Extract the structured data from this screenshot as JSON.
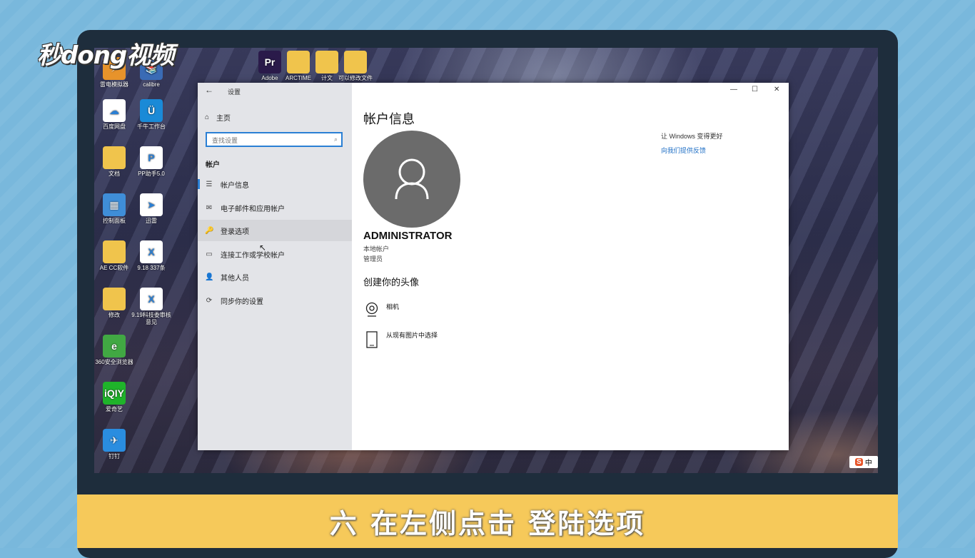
{
  "caption": "六 在左侧点击 登陆选项",
  "logo": "秒dong视频",
  "desktop_icons": [
    {
      "label": "雷电模拟器",
      "color": "#e7932b",
      "glyph": "⚡"
    },
    {
      "label": "calibre",
      "color": "#3a6bb5",
      "glyph": "📚"
    },
    {
      "label": "Adobe",
      "color": "#2a1a4a",
      "glyph": "Pr"
    },
    {
      "label": "ARCTIME",
      "color": "#f0c44c",
      "glyph": ""
    },
    {
      "label": "计文",
      "color": "#f0c44c",
      "glyph": ""
    },
    {
      "label": "可以修改文件",
      "color": "#f0c44c",
      "glyph": ""
    },
    {
      "label": "百度网盘",
      "color": "#ffffff",
      "glyph": "☁"
    },
    {
      "label": "千牛工作台",
      "color": "#1a8ad7",
      "glyph": "Ü"
    },
    {
      "label": "文档",
      "color": "#f0c44c",
      "glyph": ""
    },
    {
      "label": "PP助手5.0",
      "color": "#ffffff",
      "glyph": "P"
    },
    {
      "label": "控制面板",
      "color": "#3f8ed8",
      "glyph": "▦"
    },
    {
      "label": "迅雷",
      "color": "#ffffff",
      "glyph": "➤"
    },
    {
      "label": "AE CC软件",
      "color": "#f0c44c",
      "glyph": ""
    },
    {
      "label": "9.18 337条",
      "color": "#ffffff",
      "glyph": "X"
    },
    {
      "label": "修改",
      "color": "#f0c44c",
      "glyph": ""
    },
    {
      "label": "9.19科技委审核意见",
      "color": "#ffffff",
      "glyph": "X"
    },
    {
      "label": "360安全浏览器",
      "color": "#41a843",
      "glyph": "e"
    },
    {
      "label": "爱奇艺",
      "color": "#1fb32a",
      "glyph": "iQIY"
    },
    {
      "label": "钉钉",
      "color": "#2a8de0",
      "glyph": "✈"
    }
  ],
  "window": {
    "title": "设置",
    "back_glyph": "←",
    "controls": {
      "minimize": "—",
      "maximize": "☐",
      "close": "✕"
    },
    "home_label": "主页",
    "search_placeholder": "查找设置",
    "section": "帐户",
    "nav": [
      {
        "label": "帐户信息",
        "icon": "☰"
      },
      {
        "label": "电子邮件和应用帐户",
        "icon": "✉"
      },
      {
        "label": "登录选项",
        "icon": "🔑"
      },
      {
        "label": "连接工作或学校帐户",
        "icon": "▭"
      },
      {
        "label": "其他人员",
        "icon": "👤"
      },
      {
        "label": "同步你的设置",
        "icon": "⟳"
      }
    ],
    "main": {
      "heading": "帐户信息",
      "username": "ADMINISTRATOR",
      "account_type": "本地帐户",
      "role": "管理员",
      "create_avatar": "创建你的头像",
      "options": [
        {
          "label": "相机",
          "icon": "webcam-icon"
        },
        {
          "label": "从现有图片中选择",
          "icon": "phone-icon"
        }
      ],
      "side_text": "让 Windows 变得更好",
      "feedback_link": "向我们提供反馈"
    }
  },
  "tray": {
    "ime_label": "中"
  }
}
